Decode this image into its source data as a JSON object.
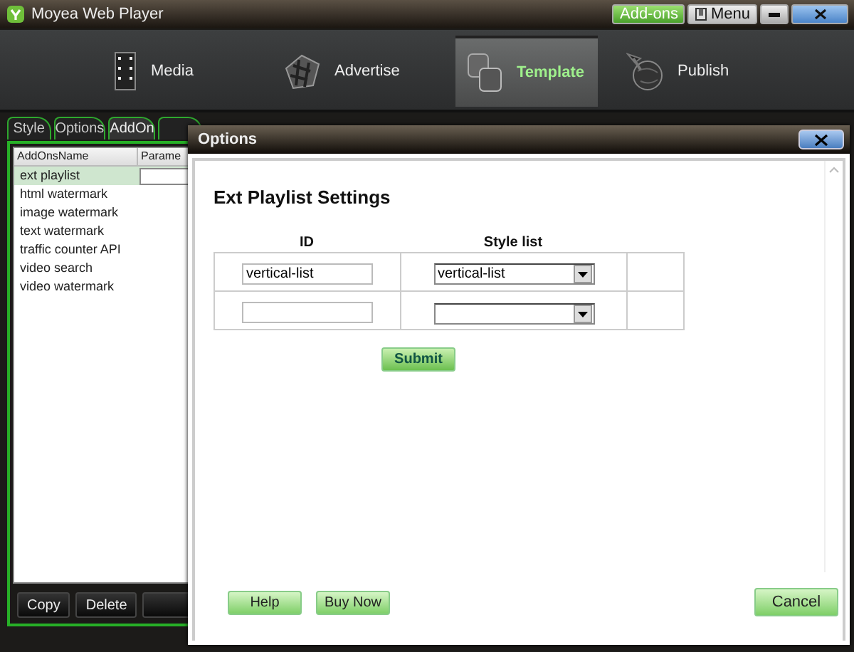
{
  "window": {
    "title": "Moyea Web Player",
    "buttons": [
      {
        "label": "Add-ons",
        "kind": "addons"
      },
      {
        "label": "Menu",
        "kind": "menu"
      }
    ]
  },
  "nav": [
    {
      "label": "Media",
      "kind": "film",
      "selected": false
    },
    {
      "label": "Advertise",
      "kind": "cube",
      "selected": false
    },
    {
      "label": "Template",
      "kind": "stack",
      "selected": true
    },
    {
      "label": "Publish",
      "kind": "globe",
      "selected": false
    }
  ],
  "tabs": [
    {
      "label": "Style",
      "selected": false
    },
    {
      "label": "Options",
      "selected": false
    },
    {
      "label": "AddOn",
      "selected": true
    }
  ],
  "addons": {
    "columns": [
      "AddOnsName",
      "Parame"
    ],
    "rows": [
      {
        "name": "ext playlist",
        "selected": true
      },
      {
        "name": "html watermark",
        "selected": false
      },
      {
        "name": "image watermark",
        "selected": false
      },
      {
        "name": "text watermark",
        "selected": false
      },
      {
        "name": "traffic counter API",
        "selected": false
      },
      {
        "name": "video search",
        "selected": false
      },
      {
        "name": "video watermark",
        "selected": false
      }
    ],
    "buttons": [
      "Copy",
      "Delete"
    ]
  },
  "dialog": {
    "title": "Options",
    "heading": "Ext Playlist Settings",
    "columns": [
      "ID",
      "Style list"
    ],
    "rows": [
      {
        "id": "vertical-list",
        "style": "vertical-list"
      },
      {
        "id": "",
        "style": ""
      }
    ],
    "submit": "Submit",
    "buttons": [
      {
        "label": "Help",
        "kind": "left"
      },
      {
        "label": "Buy Now",
        "kind": "left"
      },
      {
        "label": "Cancel",
        "kind": "right"
      }
    ]
  }
}
